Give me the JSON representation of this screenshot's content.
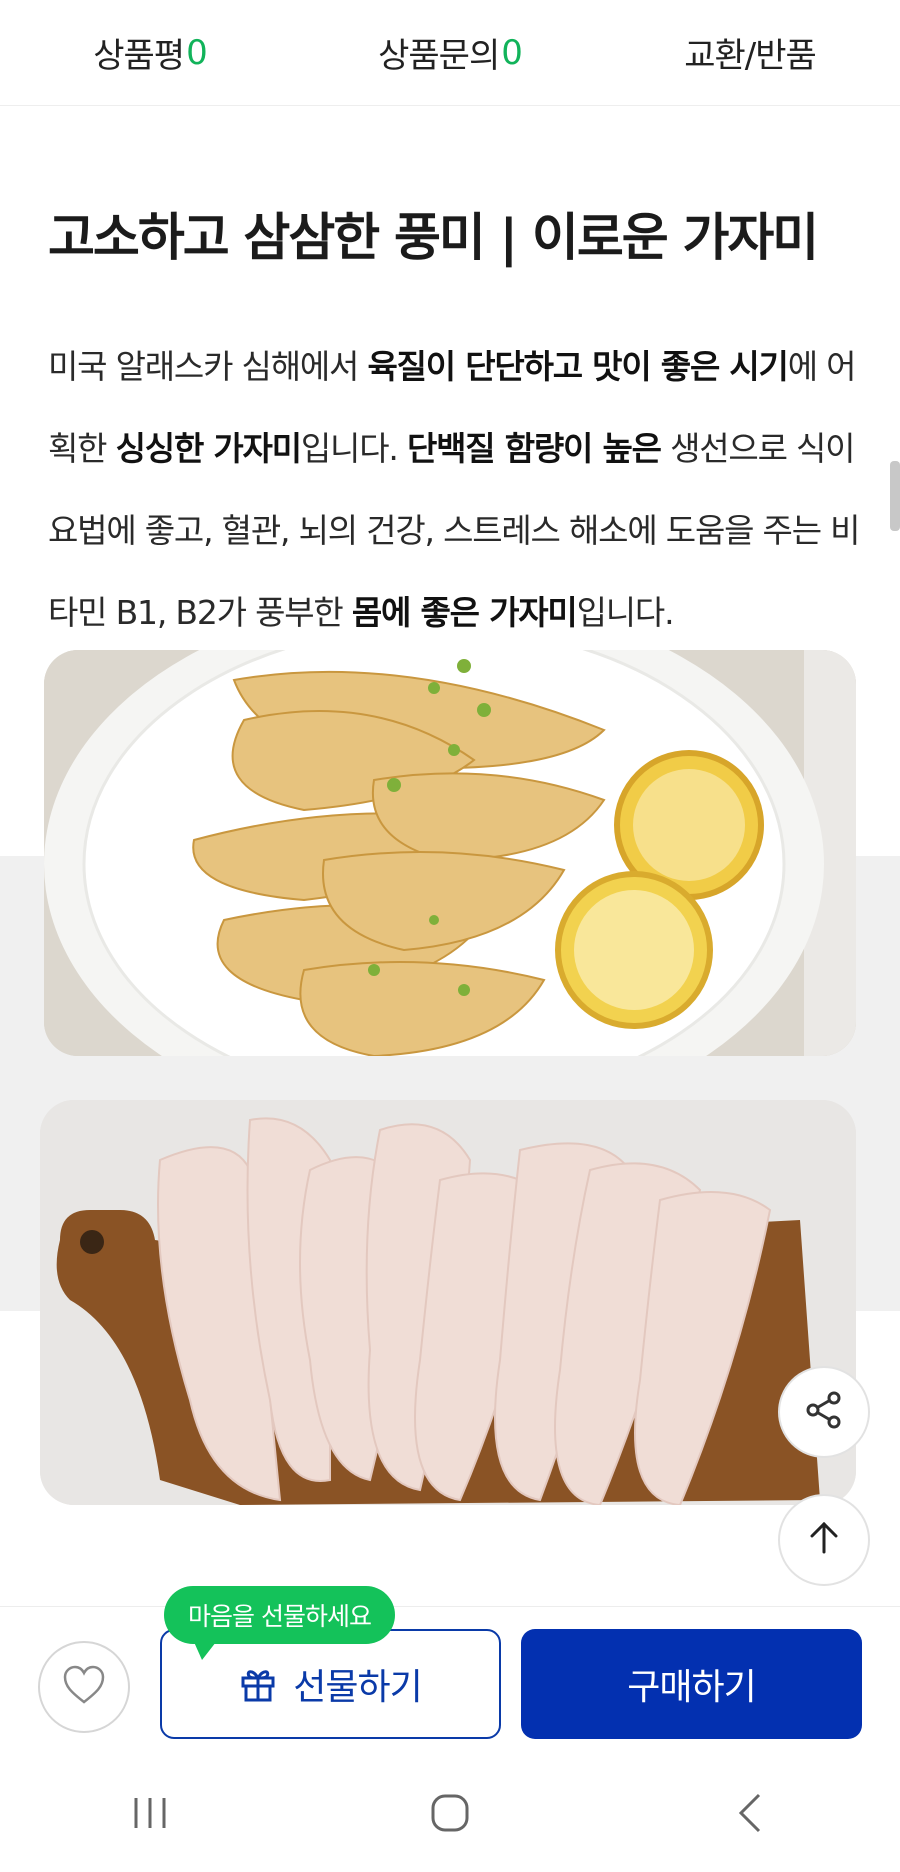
{
  "tabs": [
    {
      "label": "상품평",
      "count": "0"
    },
    {
      "label": "상품문의",
      "count": "0"
    },
    {
      "label": "교환/반품",
      "count": ""
    }
  ],
  "article": {
    "headline": "고소하고 삼삼한 풍미 | 이로운 가자미",
    "desc": {
      "p1": "미국 알래스카 심해에서 ",
      "b1": "육질이 단단하고 맛이 좋은 시기",
      "p2": "에 어획한 ",
      "b2": "싱싱한 가자미",
      "p3": "입니다. ",
      "b3": "단백질 함량이 높은",
      "p4": " 생선으로 식이요법에 좋고, 혈관, 뇌의 건강, 스트레스 해소에 도움을 주는 비타민 B1, B2가 풍부한 ",
      "b4": "몸에 좋은 가자미",
      "p5": "입니다."
    }
  },
  "images": {
    "cooked": "grilled-flounder-with-lemon-photo",
    "raw": "raw-flounder-fillets-on-board-photo"
  },
  "floating": {
    "share_icon": "share-icon",
    "top_icon": "arrow-up-icon"
  },
  "purchase": {
    "tooltip": "마음을 선물하세요",
    "gift_label": "선물하기",
    "buy_label": "구매하기",
    "accent_color": "#0330b0",
    "tooltip_color": "#14c25a"
  },
  "system_nav": [
    "recent-apps-icon",
    "home-icon",
    "back-icon"
  ]
}
